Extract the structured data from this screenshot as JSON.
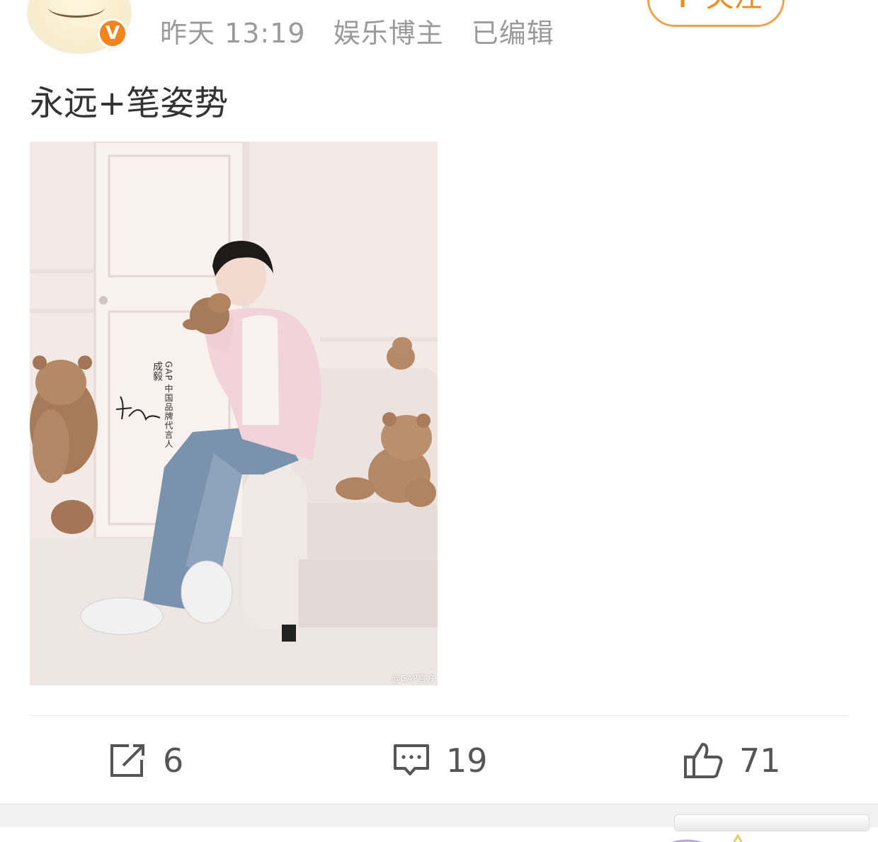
{
  "post": {
    "time": "昨天 13:19",
    "user_title": "娱乐博主",
    "edited_label": "已编辑",
    "follow_label": "关注",
    "text": "永远+笔姿势",
    "verified_badge": "V"
  },
  "photo": {
    "vertical_title": "GAP 中国品牌代言人",
    "vertical_name": "成毅",
    "watermark": "@GAP官方"
  },
  "actions": {
    "repost_count": "6",
    "comment_count": "19",
    "like_count": "71"
  },
  "icons": {
    "repost": "repost-icon",
    "comment": "comment-icon",
    "like": "thumbs-up-icon",
    "verified": "verified-badge-icon"
  },
  "colors": {
    "accent": "#f08a1d",
    "meta_text": "#9a9a9a",
    "body_text": "#333333"
  }
}
